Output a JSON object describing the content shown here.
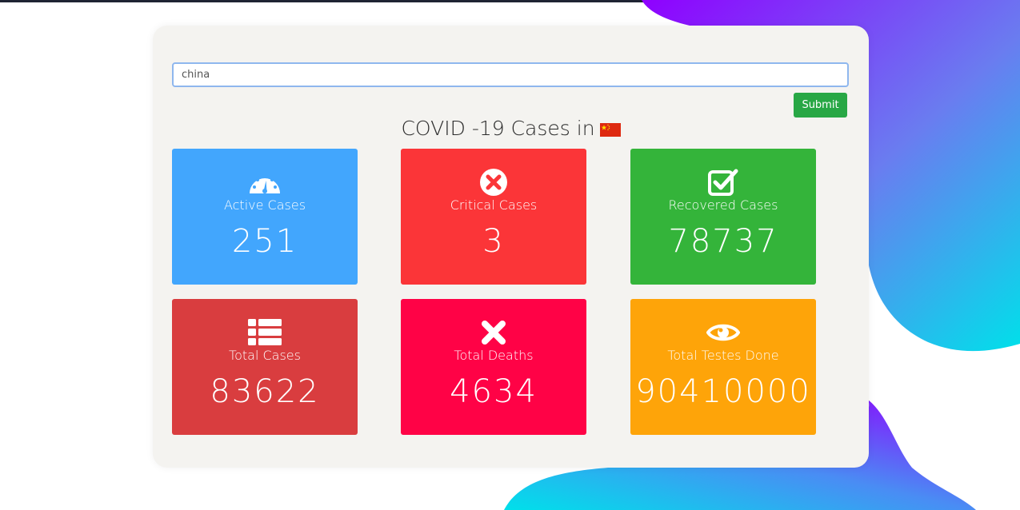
{
  "search": {
    "value": "china"
  },
  "submit_label": "Submit",
  "title": "COVID -19 Cases in",
  "flag_icon": "china-flag-icon",
  "cards": [
    {
      "label": "Active Cases",
      "value": "251",
      "icon": "gauge-icon",
      "color": "#42a6fd"
    },
    {
      "label": "Critical Cases",
      "value": "3",
      "icon": "close-circle-icon",
      "color": "#fb3538"
    },
    {
      "label": "Recovered Cases",
      "value": "78737",
      "icon": "checkbox-icon",
      "color": "#34b43a"
    },
    {
      "label": "Total Cases",
      "value": "83622",
      "icon": "list-icon",
      "color": "#d93d3f"
    },
    {
      "label": "Total Deaths",
      "value": "4634",
      "icon": "x-icon",
      "color": "#ff0246"
    },
    {
      "label": "Total Testes Done",
      "value": "90410000",
      "icon": "eye-icon",
      "color": "#fea409"
    }
  ]
}
